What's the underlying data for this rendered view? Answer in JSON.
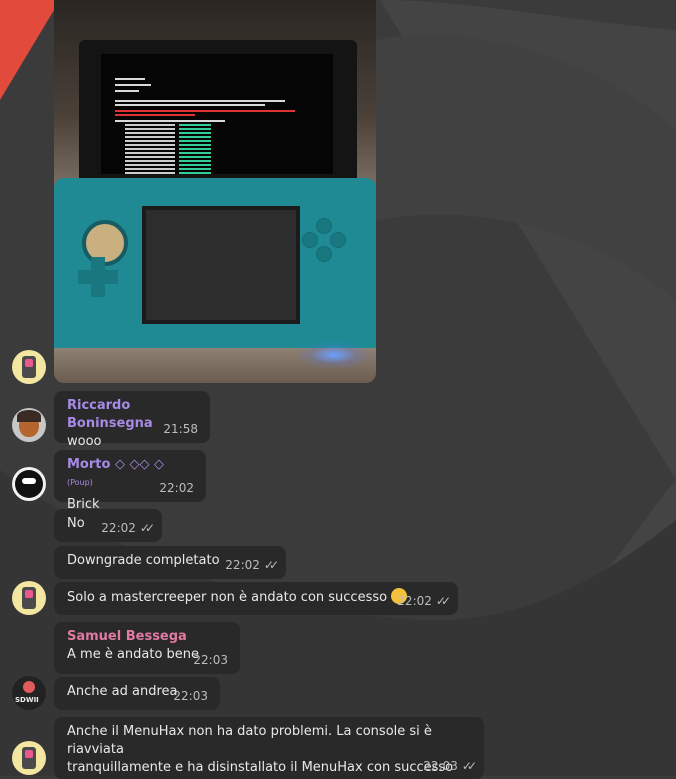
{
  "colors": {
    "name_purple": "#a78ae6",
    "name_pink": "#e07aa0",
    "bubble": "#292929",
    "background": "#3a3a3a"
  },
  "messages": [
    {
      "id": "m1",
      "sender": "Riccardo Boninsegna",
      "text": "wooo",
      "time": "21:58",
      "ticks": ""
    },
    {
      "id": "m2",
      "sender": "Morto ◇ ◇◇ ◇",
      "sender_suffix": "(Poup)",
      "text": "Brick",
      "time": "22:02",
      "ticks": ""
    },
    {
      "id": "m3",
      "text": "No",
      "time": "22:02",
      "ticks": "✓✓"
    },
    {
      "id": "m4",
      "text": "Downgrade completato",
      "time": "22:02",
      "ticks": "✓✓"
    },
    {
      "id": "m5",
      "text": "Solo a mastercreeper non è andato con successo",
      "emoji": "grinning-squinting-face",
      "time": "22:02",
      "ticks": "✓✓"
    },
    {
      "id": "m6",
      "sender": "Samuel Bessega",
      "text": "A me è andato bene",
      "time": "22:03",
      "ticks": ""
    },
    {
      "id": "m7",
      "text": "Anche ad andrea",
      "time": "22:03",
      "ticks": ""
    },
    {
      "id": "m8",
      "text_line1": "Anche il MenuHax non ha dato problemi. La console si è riavviata",
      "text_line2": "tranquillamente e ha disinstallato il MenuHax con successo",
      "time": "22:03",
      "ticks": "✓✓"
    }
  ],
  "photo": {
    "description_icon": "nintendo-3ds-photo"
  }
}
